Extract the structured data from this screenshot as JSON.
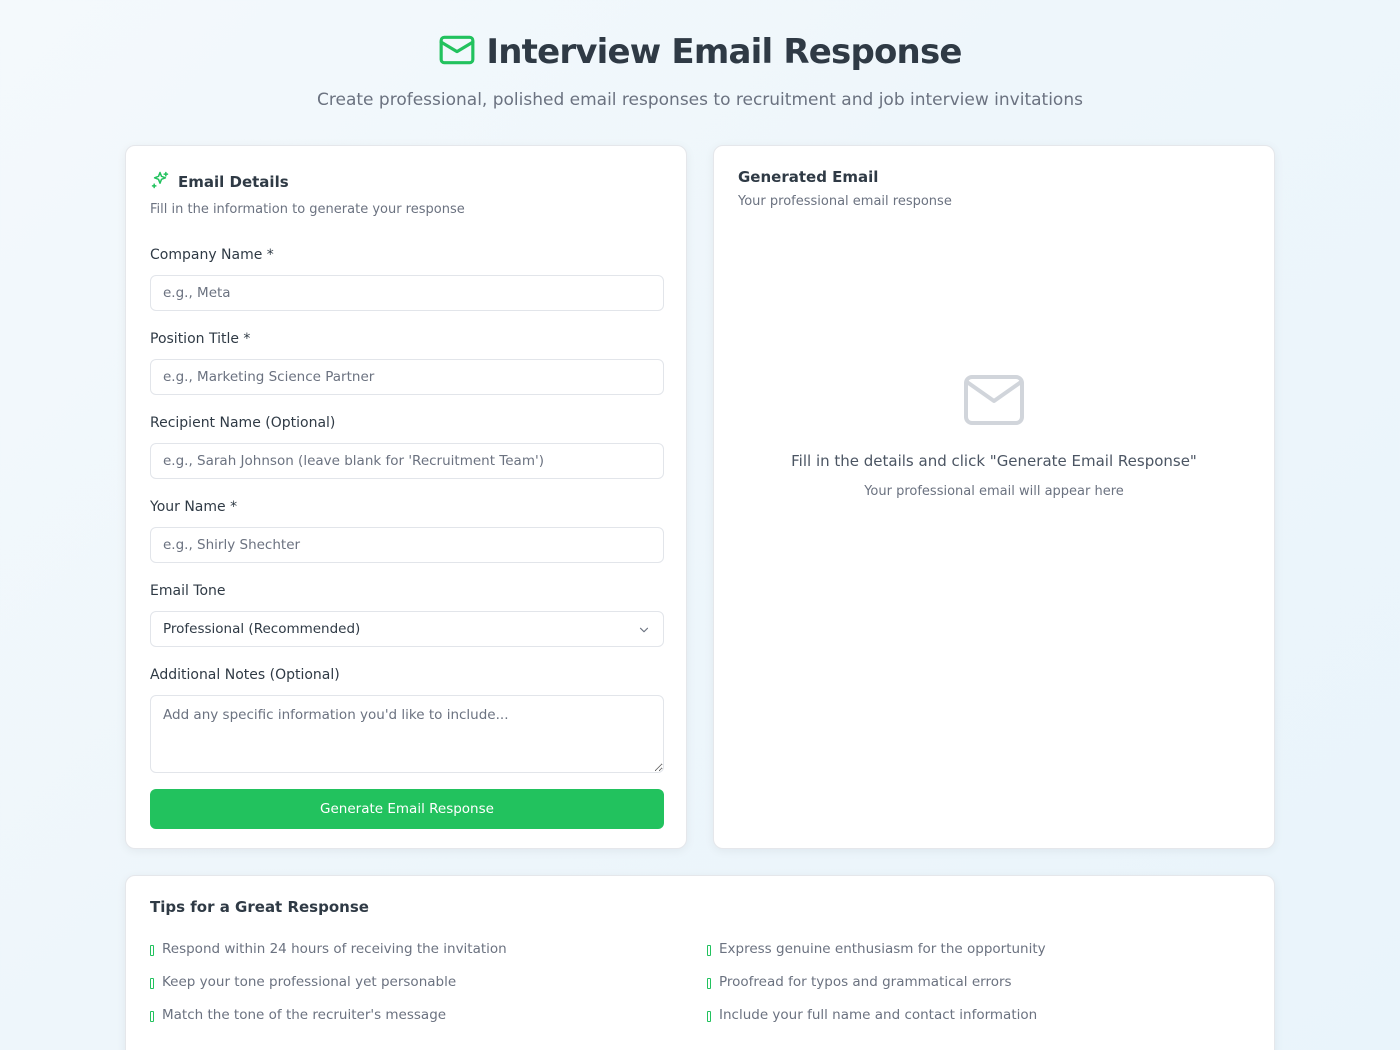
{
  "header": {
    "title": "Interview Email Response",
    "subtitle": "Create professional, polished email responses to recruitment and job interview invitations",
    "icon": "mail-icon"
  },
  "form": {
    "title": "Email Details",
    "description": "Fill in the information to generate your response",
    "icon": "sparkles-icon",
    "fields": {
      "company": {
        "label": "Company Name *",
        "placeholder": "e.g., Meta",
        "value": ""
      },
      "position": {
        "label": "Position Title *",
        "placeholder": "e.g., Marketing Science Partner",
        "value": ""
      },
      "recipient": {
        "label": "Recipient Name (Optional)",
        "placeholder": "e.g., Sarah Johnson (leave blank for 'Recruitment Team')",
        "value": ""
      },
      "your_name": {
        "label": "Your Name *",
        "placeholder": "e.g., Shirly Shechter",
        "value": ""
      },
      "tone": {
        "label": "Email Tone",
        "selected": "Professional (Recommended)"
      },
      "notes": {
        "label": "Additional Notes (Optional)",
        "placeholder": "Add any specific information you'd like to include...",
        "value": ""
      }
    },
    "submit_label": "Generate Email Response"
  },
  "output": {
    "title": "Generated Email",
    "description": "Your professional email response",
    "empty_icon": "mail-icon",
    "empty_message": "Fill in the details and click \"Generate Email Response\"",
    "empty_sub": "Your professional email will appear here"
  },
  "tips": {
    "title": "Tips for a Great Response",
    "items": [
      "Respond within 24 hours of receiving the invitation",
      "Express genuine enthusiasm for the opportunity",
      "Keep your tone professional yet personable",
      "Proofread for typos and grammatical errors",
      "Match the tone of the recruiter's message",
      "Include your full name and contact information"
    ]
  },
  "colors": {
    "accent": "#22c25e",
    "title": "#2f3a45",
    "muted": "#6b7280"
  }
}
